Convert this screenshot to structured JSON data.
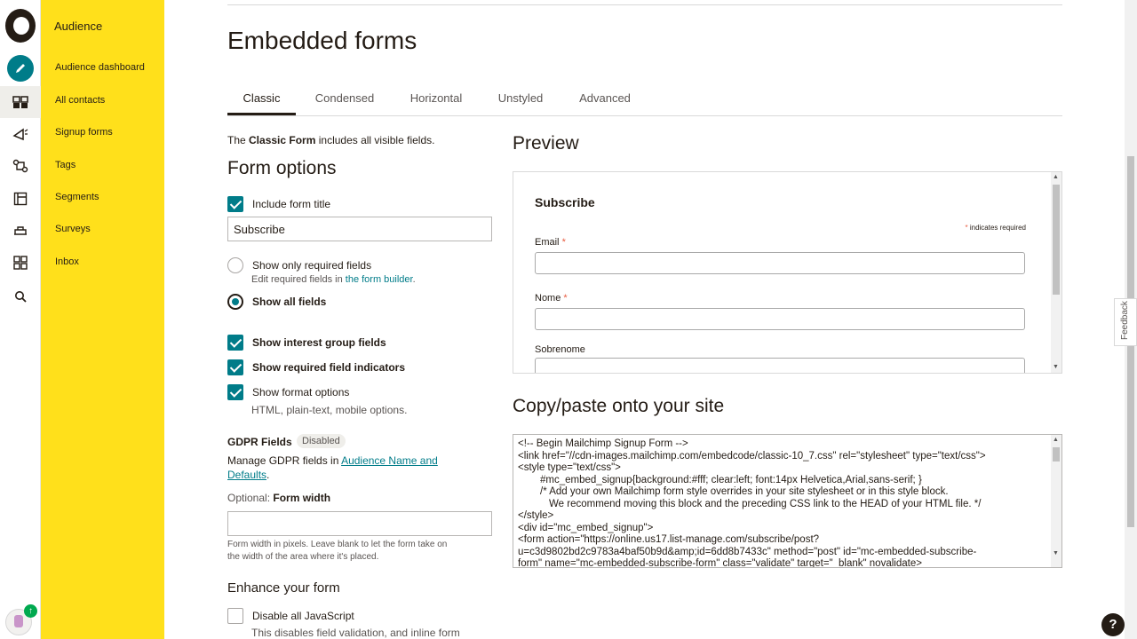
{
  "sidebar": {
    "title": "Audience",
    "items": [
      {
        "label": "Audience dashboard"
      },
      {
        "label": "All contacts"
      },
      {
        "label": "Signup forms"
      },
      {
        "label": "Tags"
      },
      {
        "label": "Segments"
      },
      {
        "label": "Surveys"
      },
      {
        "label": "Inbox"
      }
    ]
  },
  "page": {
    "title": "Embedded forms",
    "tabs": [
      {
        "label": "Classic",
        "active": true
      },
      {
        "label": "Condensed"
      },
      {
        "label": "Horizontal"
      },
      {
        "label": "Unstyled"
      },
      {
        "label": "Advanced"
      }
    ]
  },
  "options": {
    "lead_prefix": "The ",
    "lead_bold": "Classic Form",
    "lead_suffix": " includes all visible fields.",
    "heading": "Form options",
    "include_title_label": "Include form title",
    "include_title_checked": true,
    "form_title_value": "Subscribe",
    "show_required_label": "Show only required fields",
    "show_required_sub_prefix": "Edit required fields in ",
    "show_required_sub_link": "the form builder",
    "show_required_sub_suffix": ".",
    "show_all_label": "Show all fields",
    "interest_label": "Show interest group fields",
    "indicators_label": "Show required field indicators",
    "format_label": "Show format options",
    "format_sub": "HTML, plain-text, mobile options.",
    "gdpr_label": "GDPR Fields",
    "gdpr_badge": "Disabled",
    "gdpr_text_prefix": "Manage GDPR fields in ",
    "gdpr_link_1": "Audience Name and",
    "gdpr_link_2": "Defaults",
    "gdpr_text_suffix": ".",
    "width_optional": "Optional: ",
    "width_label": "Form width",
    "width_value": "",
    "width_help_1": "Form width in pixels. Leave blank to let the form take on",
    "width_help_2": "the width of the area where it's placed.",
    "enhance_heading": "Enhance your form",
    "disable_js_label": "Disable all JavaScript",
    "disable_js_sub": "This disables field validation, and inline form"
  },
  "preview": {
    "heading": "Preview",
    "form_title": "Subscribe",
    "req_star": "*",
    "req_text": " indicates required",
    "fields": [
      {
        "label": "Email",
        "required": "*"
      },
      {
        "label": "Nome",
        "required": "*"
      },
      {
        "label": "Sobrenome",
        "required": ""
      }
    ]
  },
  "code": {
    "heading": "Copy/paste onto your site",
    "lines": [
      "<!-- Begin Mailchimp Signup Form -->",
      "<link href=\"//cdn-images.mailchimp.com/embedcode/classic-10_7.css\" rel=\"stylesheet\" type=\"text/css\">",
      "<style type=\"text/css\">",
      "        #mc_embed_signup{background:#fff; clear:left; font:14px Helvetica,Arial,sans-serif; }",
      "        /* Add your own Mailchimp form style overrides in your site stylesheet or in this style block.",
      "           We recommend moving this block and the preceding CSS link to the HEAD of your HTML file. */",
      "</style>",
      "<div id=\"mc_embed_signup\">",
      "<form action=\"https://online.us17.list-manage.com/subscribe/post?",
      "u=c3d9802bd2c9783a4baf50b9d&amp;id=6dd8b7433c\" method=\"post\" id=\"mc-embedded-subscribe-",
      "form\" name=\"mc-embedded-subscribe-form\" class=\"validate\" target=\"_blank\" novalidate>"
    ]
  },
  "feedback": "Feedback",
  "help": "?",
  "colors": {
    "accent": "#007c89",
    "sidebar": "#ffe01b",
    "text": "#241c15"
  }
}
